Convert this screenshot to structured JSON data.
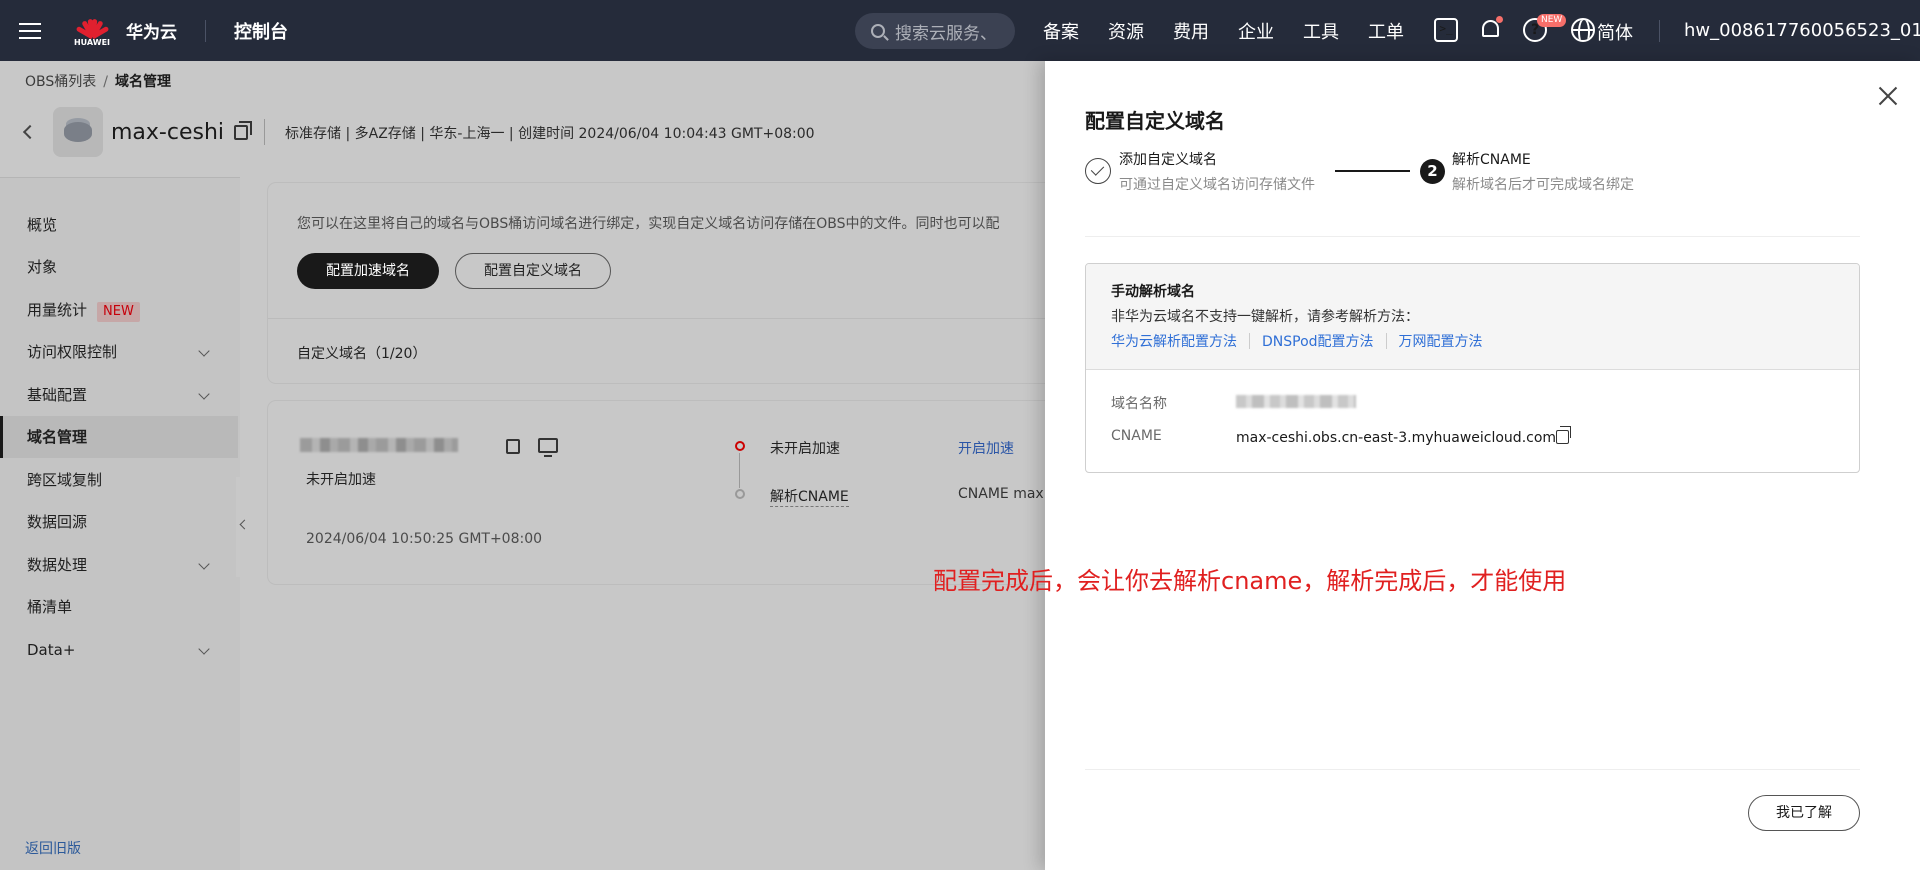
{
  "topbar": {
    "logo_word": "HUAWEI",
    "brand": "华为云",
    "console": "控制台",
    "search_placeholder": "搜索云服务、",
    "nav": [
      "备案",
      "资源",
      "费用",
      "企业",
      "工具",
      "工单"
    ],
    "new_badge": "NEW",
    "lang": "简体",
    "user": "hw_008617760056523_01"
  },
  "breadcrumb": {
    "parent": "OBS桶列表",
    "separator": "/",
    "current": "域名管理"
  },
  "bucket": {
    "name": "max-ceshi",
    "meta": "标准存储 | 多AZ存储 | 华东-上海一 | 创建时间  2024/06/04 10:04:43 GMT+08:00"
  },
  "sidebar": {
    "items": [
      {
        "label": "概览"
      },
      {
        "label": "对象"
      },
      {
        "label": "用量统计",
        "badge": "NEW"
      },
      {
        "label": "访问权限控制"
      },
      {
        "label": "基础配置"
      },
      {
        "label": "域名管理"
      },
      {
        "label": "跨区域复制"
      },
      {
        "label": "数据回源"
      },
      {
        "label": "数据处理"
      },
      {
        "label": "桶清单"
      },
      {
        "label": "Data+"
      }
    ],
    "back_link": "返回旧版"
  },
  "main": {
    "intro": "您可以在这里将自己的域名与OBS桶访问域名进行绑定，实现自定义域名访问存储在OBS中的文件。同时也可以配",
    "btn_accel": "配置加速域名",
    "btn_custom": "配置自定义域名",
    "domain_count": "自定义域名（1/20）",
    "card": {
      "status": "未开启加速",
      "time": "2024/06/04 10:50:25 GMT+08:00",
      "step1": "未开启加速",
      "step2": "解析CNAME",
      "link": "开启加速",
      "cname_prefix": "CNAME   max"
    }
  },
  "annotation": "配置完成后，会让你去解析cname，解析完成后，才能使用",
  "drawer": {
    "title": "配置自定义域名",
    "step1_title": "添加自定义域名",
    "step1_sub": "可通过自定义域名访问存储文件",
    "step2_num": "2",
    "step2_title": "解析CNAME",
    "step2_sub": "解析域名后才可完成域名绑定",
    "box_title": "手动解析域名",
    "box_desc": "非华为云域名不支持一键解析，请参考解析方法：",
    "links": [
      "华为云解析配置方法",
      "DNSPod配置方法",
      "万网配置方法"
    ],
    "label_domain": "域名名称",
    "label_cname": "CNAME",
    "cname_value": "max-ceshi.obs.cn-east-3.myhuaweicloud.com",
    "ok_button": "我已了解"
  }
}
